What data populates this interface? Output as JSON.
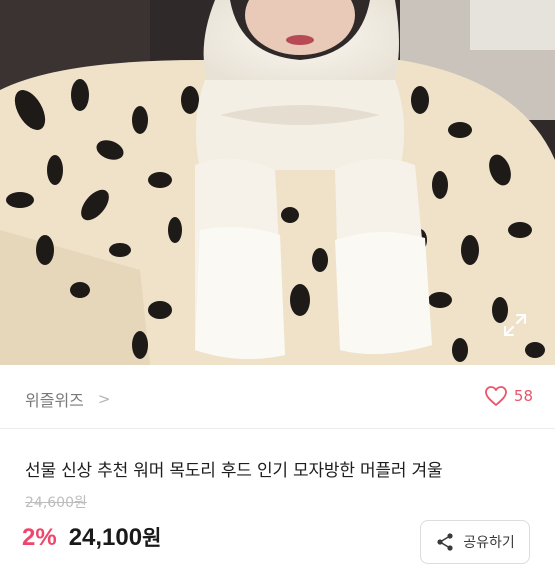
{
  "product": {
    "image_alt": "woman wearing white sherpa hooded scarf and dalmatian-print fur coat",
    "seller": "위즐위즈",
    "likes": "58",
    "title": "선물 신상 추천 워머 목도리 후드 인기 모자방한 머플러 겨울",
    "original_price": "24,600원",
    "discount": "2%",
    "price": "24,100",
    "price_unit": "원",
    "share_label": "공유하기"
  },
  "icons": {
    "expand": "expand-icon",
    "heart": "heart-icon",
    "share": "share-icon",
    "chevron": "chevron-right-icon"
  },
  "colors": {
    "accent": "#f0466b",
    "like": "#e9556a"
  }
}
